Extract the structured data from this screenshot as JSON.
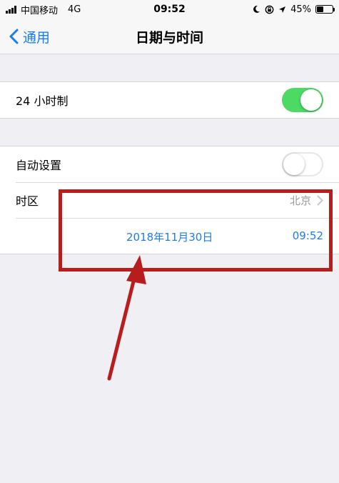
{
  "status_bar": {
    "carrier": "中国移动",
    "network": "4G",
    "time": "09:52",
    "battery_percent": "45%",
    "battery_level": 0.45,
    "icons": [
      "signal-icon",
      "moon-icon",
      "rotation-lock-icon",
      "location-icon",
      "battery-icon"
    ]
  },
  "nav": {
    "back_label": "通用",
    "title": "日期与时间"
  },
  "settings": {
    "hour24": {
      "label": "24 小时制",
      "on": true
    },
    "auto_set": {
      "label": "自动设置",
      "on": false
    },
    "timezone": {
      "label": "时区",
      "value": "北京"
    },
    "date_value": "2018年11月30日",
    "time_value": "09:52"
  },
  "colors": {
    "accent": "#1a7cf5",
    "toggle_on": "#4cd964",
    "annotation": "#b81d1d",
    "background": "#efeff4"
  }
}
